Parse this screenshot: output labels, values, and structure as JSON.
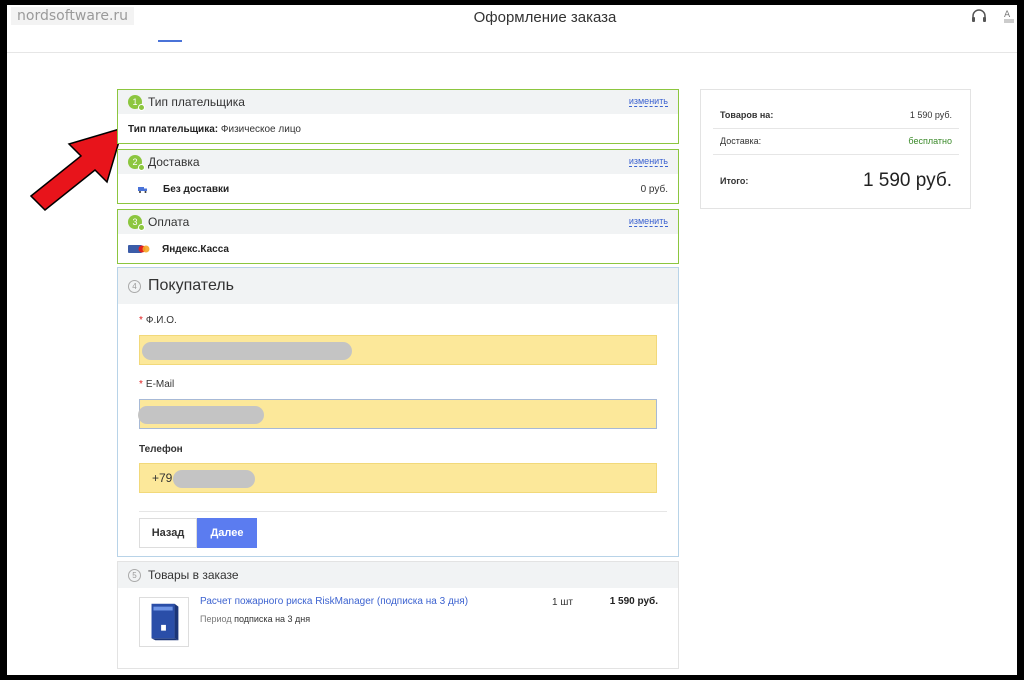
{
  "watermark": "nordsoftware.ru",
  "header": {
    "title": "Оформление заказа"
  },
  "steps": {
    "payer": {
      "num": "1",
      "title": "Тип плательщика",
      "edit": "изменить",
      "label": "Тип плательщика:",
      "value": "Физическое лицо"
    },
    "delivery": {
      "num": "2",
      "title": "Доставка",
      "edit": "изменить",
      "name": "Без доставки",
      "price": "0 руб."
    },
    "payment": {
      "num": "3",
      "title": "Оплата",
      "edit": "изменить",
      "name": "Яндекс.Касса"
    }
  },
  "buyer": {
    "num": "4",
    "title": "Покупатель",
    "fio_label": "Ф.И.О.",
    "email_label": "E-Mail",
    "phone_label": "Телефон",
    "phone_value": "+79",
    "required_mark": "*",
    "back_label": "Назад",
    "next_label": "Далее"
  },
  "products": {
    "num": "5",
    "title": "Товары в заказе",
    "item": {
      "name": "Расчет пожарного риска RiskManager (подписка на 3 дня)",
      "period_label": "Период",
      "period_value": "подписка на 3 дня",
      "qty": "1 шт",
      "price": "1 590 руб."
    }
  },
  "summary": {
    "goods_label": "Товаров на:",
    "goods_value": "1 590 руб.",
    "delivery_label": "Доставка:",
    "delivery_value": "бесплатно",
    "total_label": "Итого:",
    "total_value": "1 590 руб."
  },
  "colors": {
    "accent": "#5b7cf0",
    "done_green": "#8cc63f",
    "field_yellow": "#fce89a",
    "arrow_red": "#e8141b",
    "link": "#3d63d0"
  }
}
